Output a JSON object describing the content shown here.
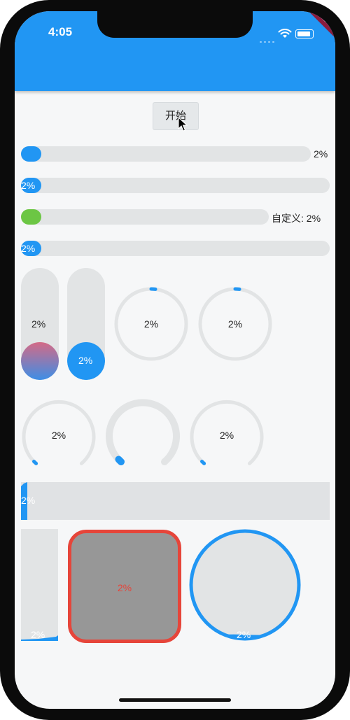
{
  "status_bar": {
    "time": "4:05",
    "debug_label": "DEBUG"
  },
  "controls": {
    "start_label": "开始"
  },
  "progress": {
    "percent": 2,
    "label": "2%",
    "custom_label": "自定义: 2%"
  },
  "colors": {
    "primary": "#2196f3",
    "track": "#e2e4e5",
    "green": "#6cc644",
    "red_border": "#e6453a",
    "grey_fill": "#979797",
    "red_text": "#e6453a",
    "gradient_top": "#d46a86"
  },
  "icons": {
    "wifi": "wifi-icon",
    "battery": "battery-icon",
    "signal": "signal-icon",
    "cursor": "mouse-cursor-icon"
  }
}
